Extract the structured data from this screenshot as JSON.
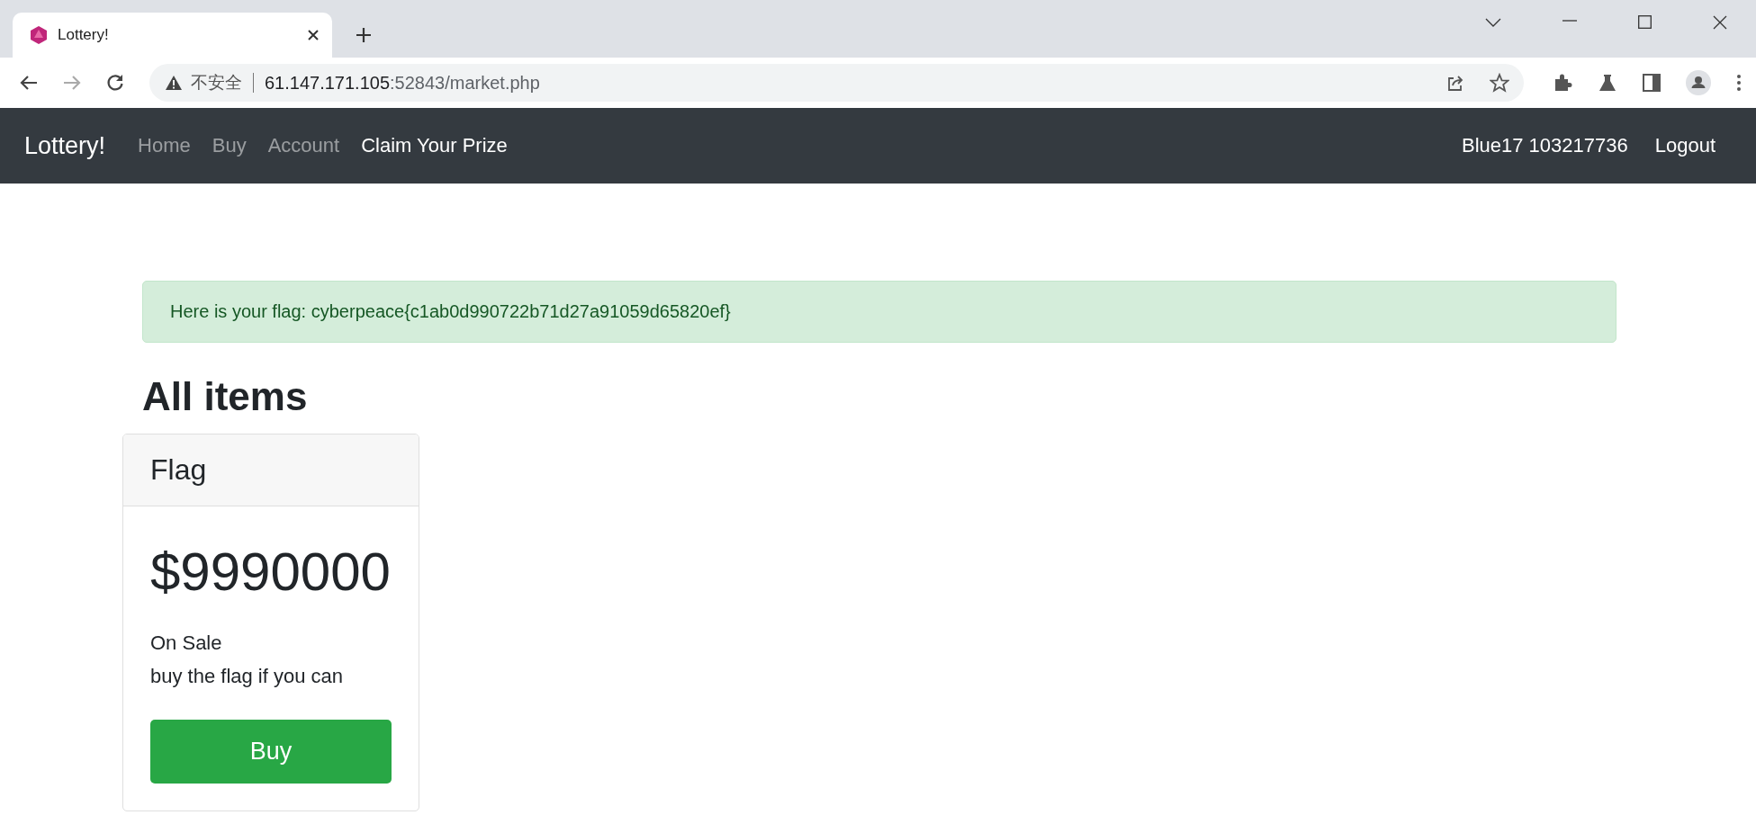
{
  "browser": {
    "tab": {
      "title": "Lottery!"
    },
    "address": {
      "security": "不安全",
      "host": "61.147.171.105",
      "path": ":52843/market.php"
    }
  },
  "navbar": {
    "brand": "Lottery!",
    "links": [
      {
        "label": "Home",
        "selected": false
      },
      {
        "label": "Buy",
        "selected": false
      },
      {
        "label": "Account",
        "selected": false
      },
      {
        "label": "Claim Your Prize",
        "selected": true
      }
    ],
    "user": "Blue17 103217736",
    "logout": "Logout"
  },
  "alert": {
    "message": "Here is your flag: cyberpeace{c1ab0d990722b71d27a91059d65820ef}"
  },
  "heading": "All items",
  "items": [
    {
      "name": "Flag",
      "price": "$9990000",
      "status": "On Sale",
      "description": "buy the flag if you can",
      "button": "Buy"
    }
  ]
}
